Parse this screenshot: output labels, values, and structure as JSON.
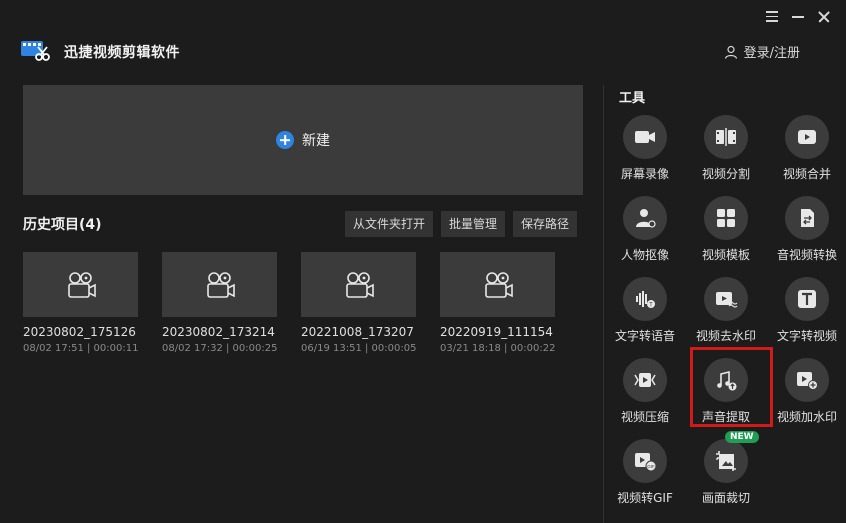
{
  "app": {
    "title": "迅捷视频剪辑软件"
  },
  "header": {
    "login_label": "登录/注册"
  },
  "new_project": {
    "label": "新建"
  },
  "history": {
    "title": "历史项目(4)",
    "buttons": [
      "从文件夹打开",
      "批量管理",
      "保存路径"
    ],
    "items": [
      {
        "name": "20230802_175126",
        "meta": "08/02 17:51 | 00:00:11"
      },
      {
        "name": "20230802_173214",
        "meta": "08/02 17:32 | 00:00:25"
      },
      {
        "name": "20221008_173207",
        "meta": "06/19 13:51 | 00:00:05"
      },
      {
        "name": "20220919_111154",
        "meta": "03/21 18:18 | 00:00:22"
      }
    ]
  },
  "tools": {
    "title": "工具",
    "items": [
      {
        "label": "屏幕录像",
        "icon": "screen-record-icon"
      },
      {
        "label": "视频分割",
        "icon": "video-split-icon"
      },
      {
        "label": "视频合并",
        "icon": "video-merge-icon"
      },
      {
        "label": "人物抠像",
        "icon": "person-cutout-icon"
      },
      {
        "label": "视频模板",
        "icon": "video-template-icon"
      },
      {
        "label": "音视频转换",
        "icon": "av-convert-icon"
      },
      {
        "label": "文字转语音",
        "icon": "text-to-speech-icon"
      },
      {
        "label": "视频去水印",
        "icon": "remove-watermark-icon"
      },
      {
        "label": "文字转视频",
        "icon": "text-to-video-icon"
      },
      {
        "label": "视频压缩",
        "icon": "video-compress-icon"
      },
      {
        "label": "声音提取",
        "icon": "audio-extract-icon"
      },
      {
        "label": "视频加水印",
        "icon": "add-watermark-icon"
      },
      {
        "label": "视频转GIF",
        "icon": "video-to-gif-icon"
      },
      {
        "label": "画面裁切",
        "icon": "crop-icon"
      }
    ],
    "new_badge": "NEW"
  },
  "colors": {
    "accent_blue": "#2e84e0",
    "highlight_red": "#d11a1a",
    "badge_green": "#1f9e54"
  }
}
